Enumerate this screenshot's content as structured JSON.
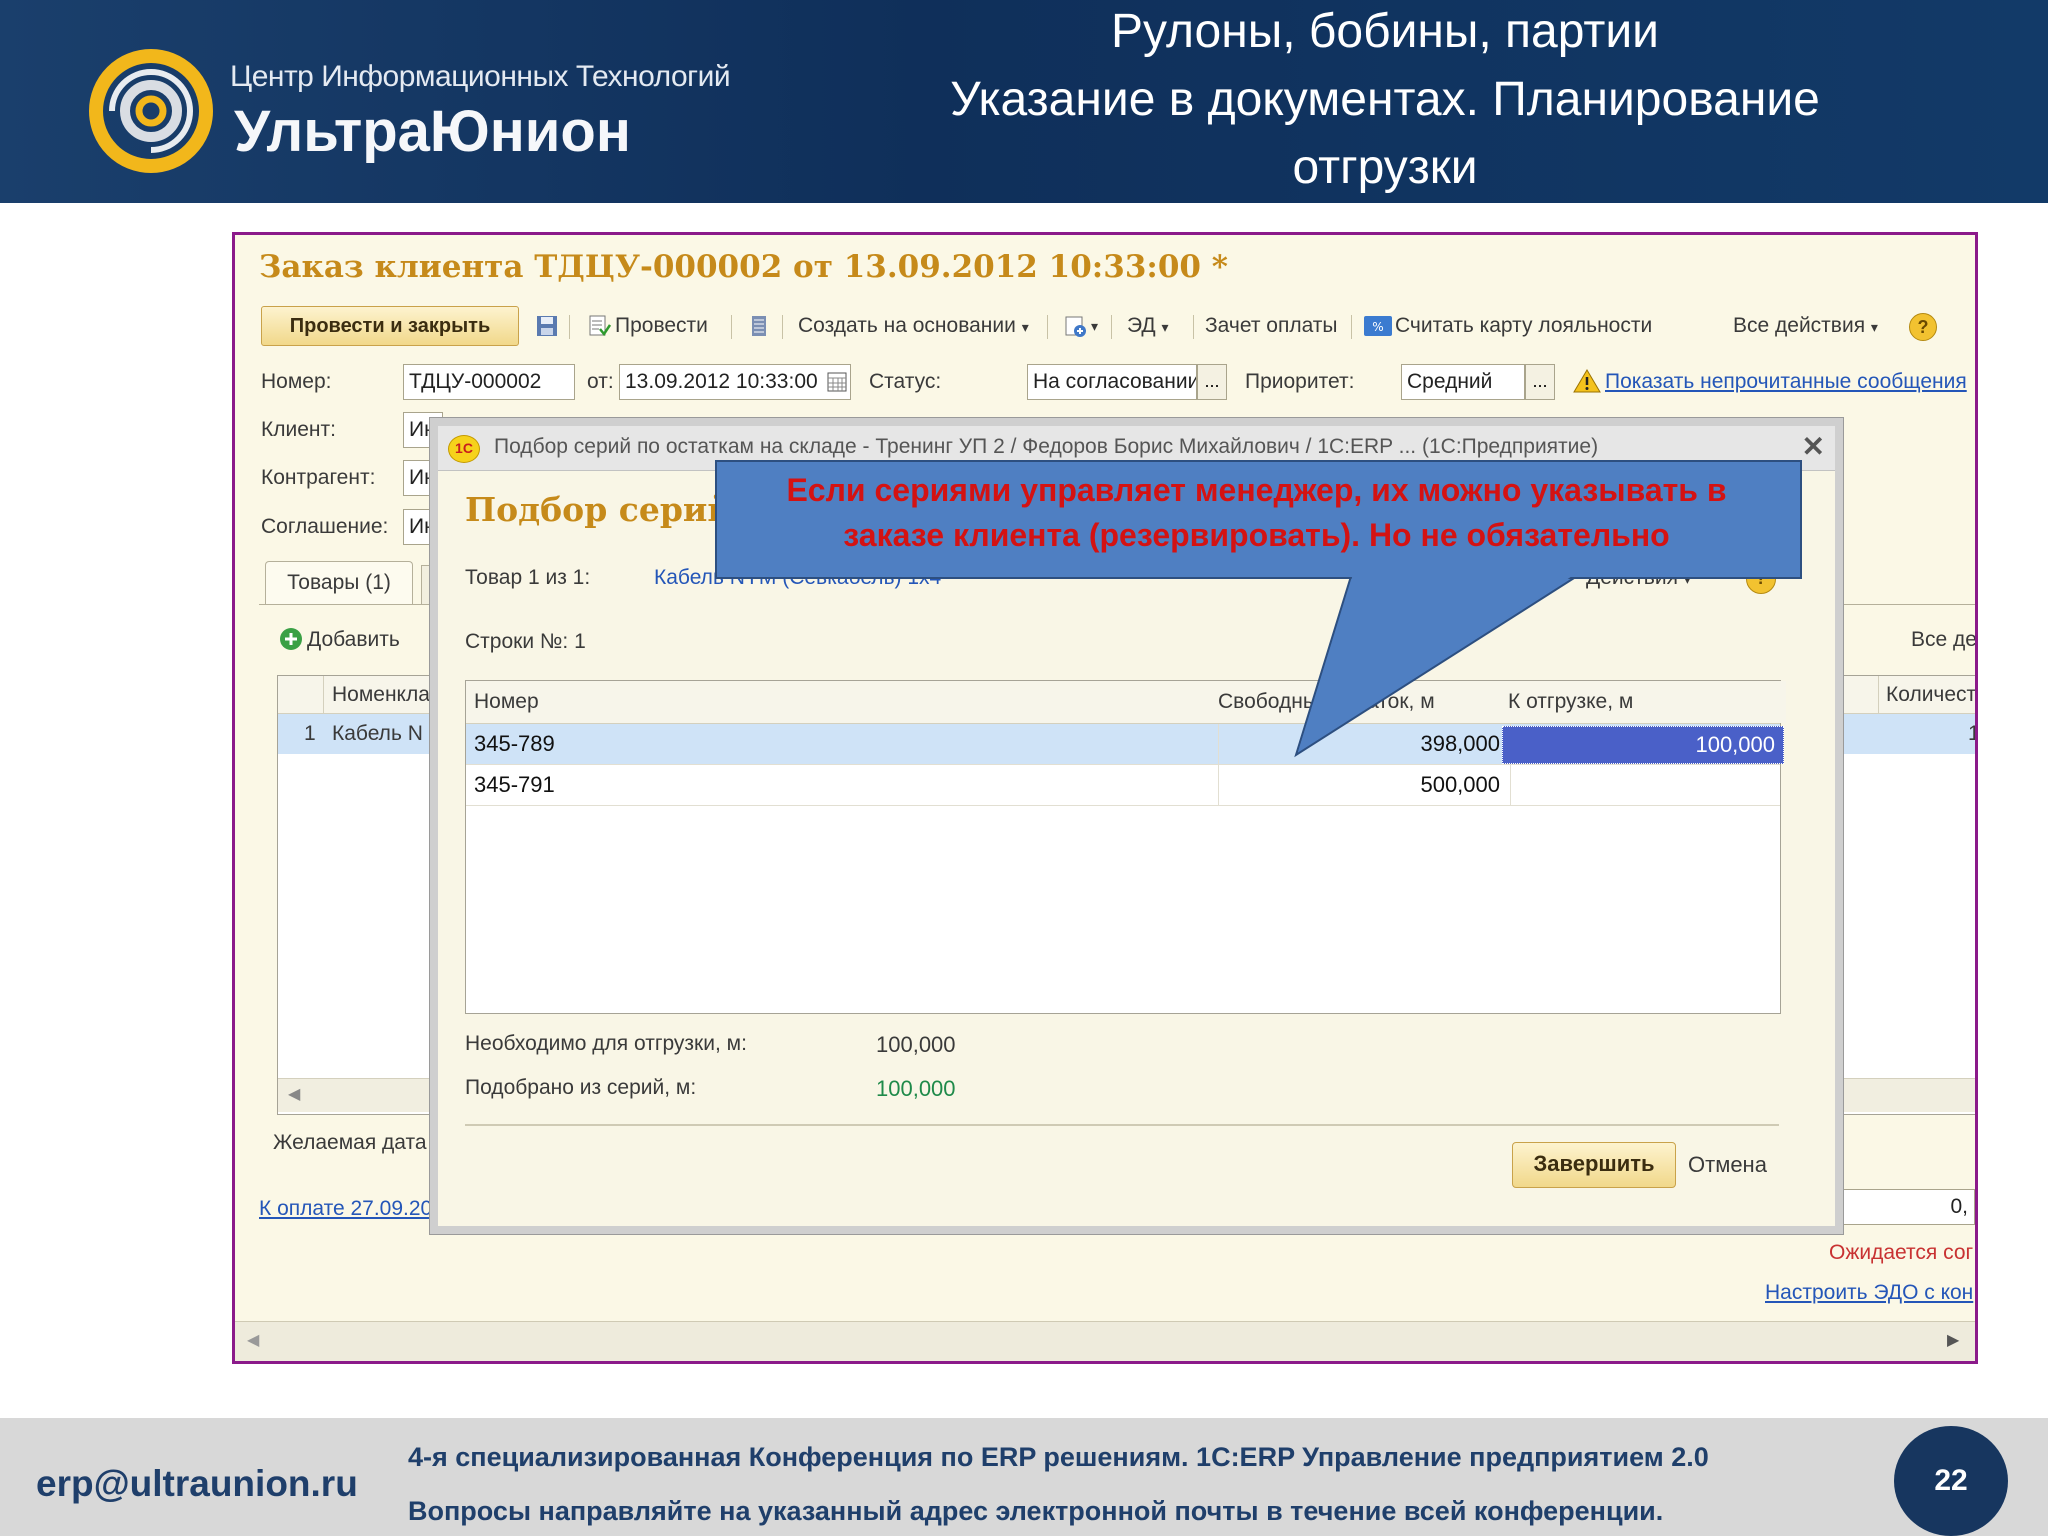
{
  "slide": {
    "title_lines": [
      "Рулоны, бобины, партии",
      "Указание в документах. Планирование",
      "отгрузки"
    ],
    "logo_line1": "Центр Информационных Технологий",
    "logo_line2": "УльтраЮнион",
    "footer_email": "erp@ultraunion.ru",
    "footer_line1": "4-я специализированная Конференция  по ERP решениям. 1С:ERP Управление предприятием 2.0",
    "footer_line2": "Вопросы направляйте на указанный адрес электронной почты в течение всей конференции.",
    "page_number": "22"
  },
  "document": {
    "title": "Заказ клиента ТДЦУ-000002 от 13.09.2012 10:33:00 *",
    "toolbar": {
      "post_close": "Провести и закрыть",
      "post": "Провести",
      "create_based": "Создать на основании",
      "ed": "ЭД",
      "payment_offset": "Зачет оплаты",
      "loyalty": "Считать карту лояльности",
      "all_actions": "Все действия",
      "help": "?"
    },
    "fields": {
      "number_label": "Номер:",
      "number_value": "ТДЦУ-000002",
      "from_label": "от:",
      "date_value": "13.09.2012 10:33:00",
      "status_label": "Статус:",
      "status_value": "На согласовании",
      "priority_label": "Приоритет:",
      "priority_value": "Средний",
      "show_messages": "Показать непрочитанные сообщения",
      "client_label": "Клиент:",
      "client_value": "Ин",
      "contractor_label": "Контрагент:",
      "contractor_value": "Ин",
      "agreement_label": "Соглашение:",
      "agreement_value": "Ин"
    },
    "tabs": {
      "goods": "Товары (1)"
    },
    "add_button": "Добавить",
    "all_actions_right": "Все де",
    "table": {
      "col_nomenclature": "Номенкла",
      "col_quantity": "Количест",
      "row_num": "1",
      "row_name": "Кабель N",
      "row_qty": "1("
    },
    "desired_date": "Желаемая дата",
    "payment_link": "К оплате 27.09.20",
    "right_value": "0,",
    "awaiting": "Ожидается сог",
    "setup_edo": "Настроить ЭДО с кон"
  },
  "dialog": {
    "window_title": "Подбор серий по остаткам на складе - Тренинг УП 2 / Федоров Борис Михайлович / 1С:ERP ...  (1С:Предприятие)",
    "heading": "Подбор серий",
    "goods_label": "Товар 1 из 1:",
    "goods_value": "Кабель NYM (Севкабель) 1х4",
    "rows_label": "Строки №: 1",
    "actions_label": "Действия",
    "columns": [
      "Номер",
      "Свободный остаток, м",
      "К отгрузке, м"
    ],
    "rows": [
      {
        "number": "345-789",
        "free": "398,000",
        "ship": "100,000"
      },
      {
        "number": "345-791",
        "free": "500,000",
        "ship": ""
      }
    ],
    "need_label": "Необходимо для отгрузки, м:",
    "need_value": "100,000",
    "picked_label": "Подобрано из серий, м:",
    "picked_value": "100,000",
    "finish_button": "Завершить",
    "cancel_button": "Отмена"
  },
  "callout": {
    "line1": "Если сериями управляет менеджер, их можно указывать в",
    "line2": "заказе клиента (резервировать). Но не обязательно"
  },
  "colors": {
    "header_bg": "#123a68",
    "frame_border": "#8b1a8a",
    "doc_title": "#c68a1a",
    "callout_fill": "#4f7fc2",
    "callout_text": "#d41212",
    "selected_cell": "#4a60c8"
  }
}
